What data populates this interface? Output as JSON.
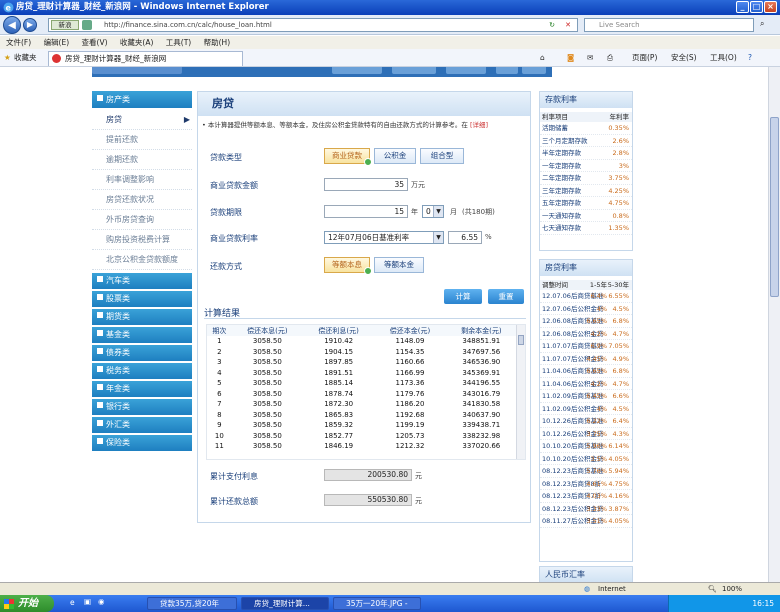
{
  "window": {
    "title": "房贷_理财计算器_财经_新浪网 - Windows Internet Explorer",
    "address": "http://finance.sina.com.cn/calc/house_loan.html",
    "address_tag": "新浪",
    "search_placeholder": "Live Search"
  },
  "menu": [
    "文件(F)",
    "编辑(E)",
    "查看(V)",
    "收藏夹(A)",
    "工具(T)",
    "帮助(H)"
  ],
  "favbar": {
    "favorites": "收藏夹",
    "tab": "房贷_理财计算器_财经_新浪网",
    "page": "页面(P)",
    "safety": "安全(S)",
    "tools": "工具(O)"
  },
  "sidebar": {
    "head": "房产类",
    "items": [
      "房贷",
      "提前还款",
      "逾期还款",
      "利率调整影响",
      "房贷还款状况",
      "外币房贷查询",
      "购房投资税费计算",
      "北京公积金贷款额度"
    ],
    "categories": [
      "汽车类",
      "股票类",
      "期货类",
      "基金类",
      "债券类",
      "税务类",
      "年金类",
      "银行类",
      "外汇类",
      "保险类"
    ]
  },
  "calc": {
    "title": "房贷",
    "note": "• 本计算器提供等额本息、等额本金，及住房公积金贷款特有的自由还款方式的计算参考。在",
    "note_more": "[详细]",
    "loan_type_label": "贷款类型",
    "loan_types": [
      "商业贷款",
      "公积金",
      "组合型"
    ],
    "amount_label": "商业贷款金额",
    "amount": "35",
    "amount_unit": "万元",
    "term_label": "贷款期限",
    "years": "15",
    "year_unit": "年",
    "months": "0",
    "month_unit": "月",
    "term_note": "(共180期)",
    "rate_label": "商业贷款利率",
    "rate_option": "12年07月06日基准利率",
    "rate": "6.55",
    "rate_unit": "%",
    "method_label": "还款方式",
    "methods": [
      "等额本息",
      "等额本金"
    ],
    "calc_button": "计算",
    "reset_button": "重置",
    "results_title": "计算结果",
    "columns": [
      "期次",
      "偿还本息(元)",
      "偿还利息(元)",
      "偿还本金(元)",
      "剩余本金(元)"
    ],
    "rows": [
      [
        "1",
        "3058.50",
        "1910.42",
        "1148.09",
        "348851.91"
      ],
      [
        "2",
        "3058.50",
        "1904.15",
        "1154.35",
        "347697.56"
      ],
      [
        "3",
        "3058.50",
        "1897.85",
        "1160.66",
        "346536.90"
      ],
      [
        "4",
        "3058.50",
        "1891.51",
        "1166.99",
        "345369.91"
      ],
      [
        "5",
        "3058.50",
        "1885.14",
        "1173.36",
        "344196.55"
      ],
      [
        "6",
        "3058.50",
        "1878.74",
        "1179.76",
        "343016.79"
      ],
      [
        "7",
        "3058.50",
        "1872.30",
        "1186.20",
        "341830.58"
      ],
      [
        "8",
        "3058.50",
        "1865.83",
        "1192.68",
        "340637.90"
      ],
      [
        "9",
        "3058.50",
        "1859.32",
        "1199.19",
        "339438.71"
      ],
      [
        "10",
        "3058.50",
        "1852.77",
        "1205.73",
        "338232.98"
      ],
      [
        "11",
        "3058.50",
        "1846.19",
        "1212.32",
        "337020.66"
      ]
    ],
    "total_paid_label": "累计支付利息",
    "total_paid": "200530.80",
    "total_paid_unit": "元",
    "total_repay_label": "累计还款总额",
    "total_repay": "550530.80",
    "total_repay_unit": "元"
  },
  "deposit": {
    "title": "存款利率",
    "col1": "利率项目",
    "col2": "年利率",
    "rows": [
      [
        "活期储蓄",
        "0.35%"
      ],
      [
        "三个月定期存款",
        "2.6%"
      ],
      [
        "半年定期存款",
        "2.8%"
      ],
      [
        "一年定期存款",
        "3%"
      ],
      [
        "二年定期存款",
        "3.75%"
      ],
      [
        "三年定期存款",
        "4.25%"
      ],
      [
        "五年定期存款",
        "4.75%"
      ],
      [
        "一天通知存款",
        "0.8%"
      ],
      [
        "七天通知存款",
        "1.35%"
      ]
    ]
  },
  "housing": {
    "title": "房贷利率",
    "col1": "调整时间",
    "col2": "1-5年",
    "col3": "5-30年",
    "rows": [
      [
        "12.07.06后商贷基准",
        "6.4%",
        "6.55%"
      ],
      [
        "12.07.06后公积金贷",
        "4%",
        "4.5%"
      ],
      [
        "12.06.08后商贷基准",
        "6.65%",
        "6.8%"
      ],
      [
        "12.06.08后公积金贷",
        "4.2%",
        "4.7%"
      ],
      [
        "11.07.07后商贷基准",
        "6.9%",
        "7.05%"
      ],
      [
        "11.07.07后公积金贷",
        "4.45%",
        "4.9%"
      ],
      [
        "11.04.06后商贷基准",
        "6.65%",
        "6.8%"
      ],
      [
        "11.04.06后公积金贷",
        "4.2%",
        "4.7%"
      ],
      [
        "11.02.09后商贷基准",
        "6.45%",
        "6.6%"
      ],
      [
        "11.02.09后公积金贷",
        "4%",
        "4.5%"
      ],
      [
        "10.12.26后商贷基准",
        "6.22%",
        "6.4%"
      ],
      [
        "10.12.26后公积金贷",
        "3.75%",
        "4.3%"
      ],
      [
        "10.10.20后商贷基准",
        "5.96%",
        "6.14%"
      ],
      [
        "10.10.20后公积金贷",
        "3.5%",
        "4.05%"
      ],
      [
        "08.12.23后商贷基准",
        "5.76%",
        "5.94%"
      ],
      [
        "08.12.23后商贷8折",
        "4.61%",
        "4.75%"
      ],
      [
        "08.12.23后商贷7折",
        "4.03%",
        "4.16%"
      ],
      [
        "08.12.23后公积金贷",
        "3.33%",
        "3.87%"
      ],
      [
        "08.11.27后公积金贷",
        "3.51%",
        "4.05%"
      ]
    ]
  },
  "rmb_title": "人民币汇率",
  "status": {
    "zone": "Internet",
    "zoom": "100%"
  },
  "taskbar": {
    "start": "开始",
    "tasks": [
      "贷款35万,贷20年",
      "房贷_理财计算...",
      "35万一20年.JPG -"
    ],
    "time": "16:15"
  }
}
